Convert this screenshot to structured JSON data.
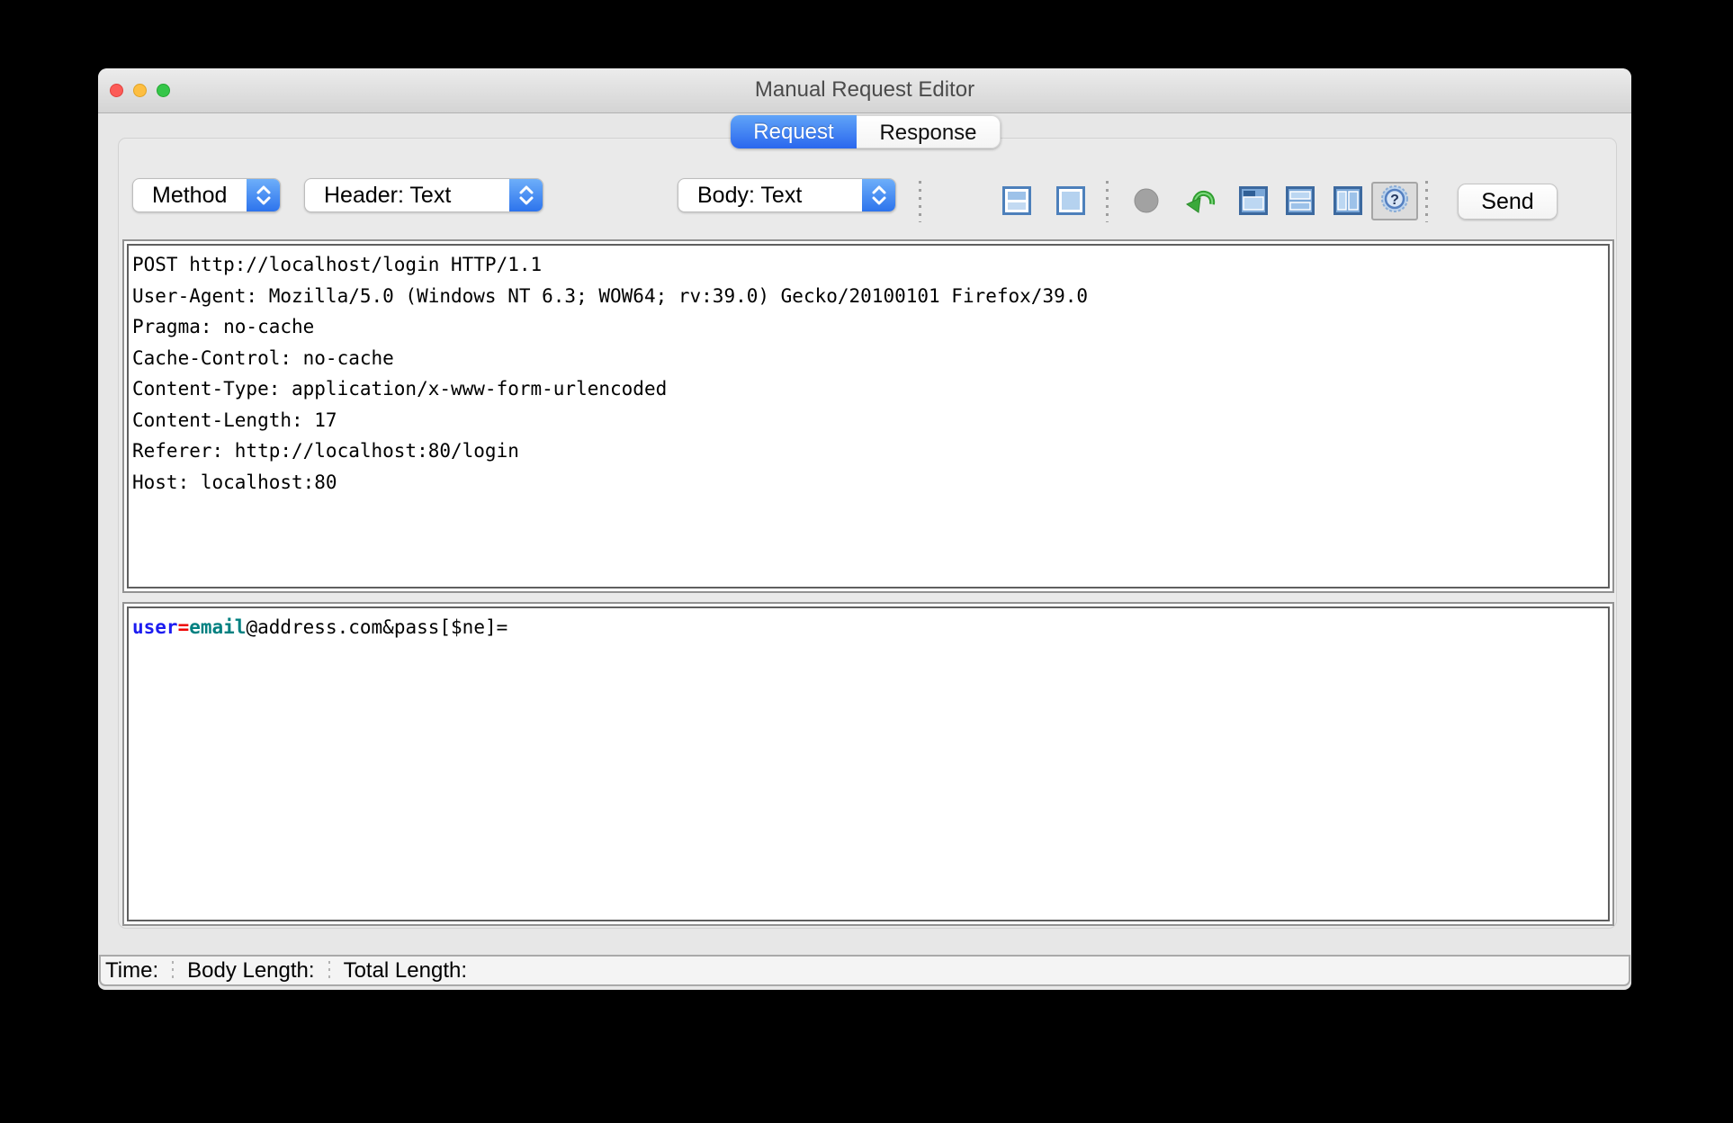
{
  "window": {
    "title": "Manual Request Editor",
    "traffic_lights": [
      "close",
      "minimize",
      "zoom"
    ]
  },
  "tabs": {
    "request": "Request",
    "response": "Response",
    "selected": "Request"
  },
  "toolbar": {
    "method_dropdown": "Method",
    "header_view_dropdown": "Header: Text",
    "body_view_dropdown": "Body: Text",
    "send_label": "Send",
    "icons": [
      "split-view-icon",
      "single-view-icon",
      "record-icon",
      "redirect-arrow-icon",
      "tab-view-icon",
      "horizontal-split-icon",
      "vertical-split-icon",
      "help-icon"
    ]
  },
  "request_header": {
    "lines": [
      "POST http://localhost/login HTTP/1.1",
      "User-Agent: Mozilla/5.0 (Windows NT 6.3; WOW64; rv:39.0) Gecko/20100101 Firefox/39.0",
      "Pragma: no-cache",
      "Cache-Control: no-cache",
      "Content-Type: application/x-www-form-urlencoded",
      "Content-Length: 17",
      "Referer: http://localhost:80/login",
      "Host: localhost:80"
    ]
  },
  "request_body": {
    "text": "user=email@address.com&pass[$ne]=",
    "segments": [
      {
        "text": "user",
        "type": "name"
      },
      {
        "text": "=",
        "type": "eq"
      },
      {
        "text": "email",
        "type": "value"
      },
      {
        "text": "@address.com&pass[$ne]=",
        "type": "plain"
      }
    ]
  },
  "status_bar": {
    "time_label": "Time:",
    "body_length_label": "Body Length:",
    "total_length_label": "Total Length:"
  },
  "colors": {
    "selected_tab_blue": "#3c7ef2",
    "dropdown_cap_blue": "#3b82f0",
    "param_name_blue": "#1c1cf0",
    "equals_red": "#ee0000",
    "param_value_teal": "#008080",
    "traffic_red": "#fc5b57",
    "traffic_yellow": "#fdbe41",
    "traffic_green": "#35c649",
    "icon_steel_blue": "#4d80bb",
    "icon_light_blue": "#b5d2ef",
    "arrow_green": "#3aa93a"
  }
}
